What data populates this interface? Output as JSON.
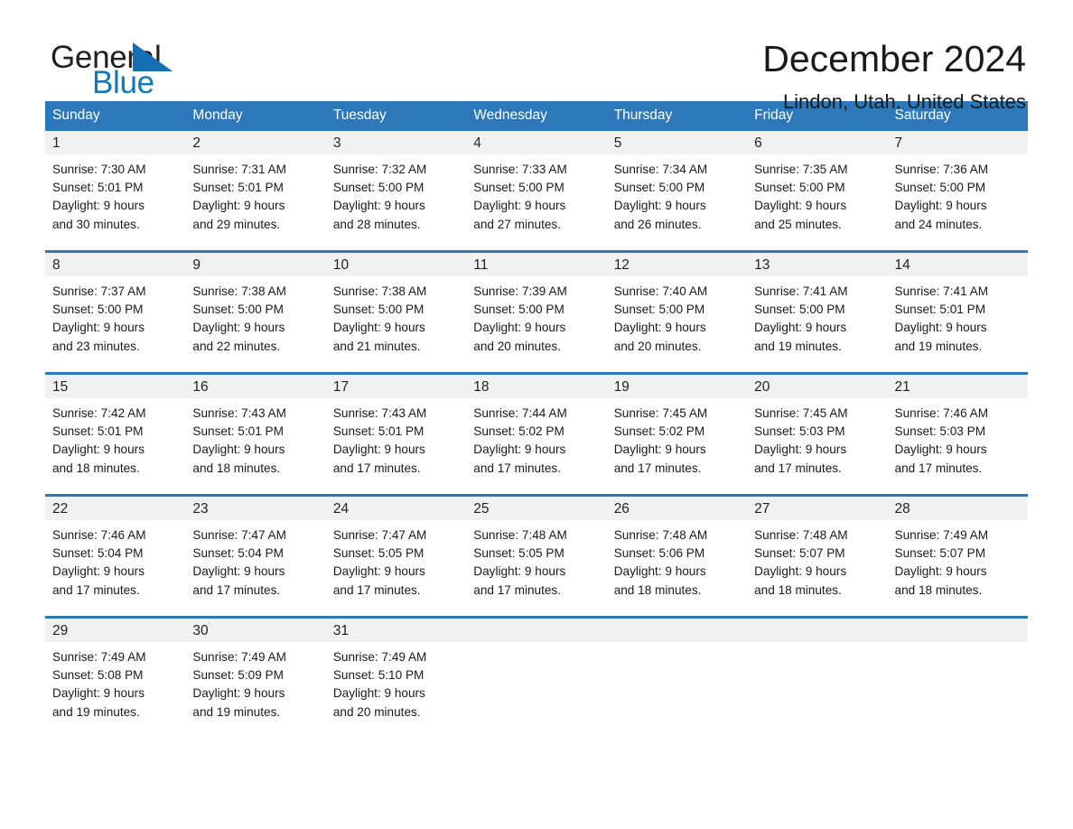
{
  "brand": {
    "name_part1": "General",
    "name_part2": "Blue",
    "triangle_color": "#1470b6",
    "blue_text_color": "#1278be"
  },
  "header": {
    "title": "December 2024",
    "subtitle": "Lindon, Utah, United States"
  },
  "colors": {
    "header_blue": "#2c78b9",
    "daynum_bg": "#f1f1f1",
    "text": "#1a1a1a"
  },
  "weekdays": [
    "Sunday",
    "Monday",
    "Tuesday",
    "Wednesday",
    "Thursday",
    "Friday",
    "Saturday"
  ],
  "weeks": [
    [
      {
        "day": "1",
        "sunrise": "Sunrise: 7:30 AM",
        "sunset": "Sunset: 5:01 PM",
        "daylight_line1": "Daylight: 9 hours",
        "daylight_line2": "and 30 minutes."
      },
      {
        "day": "2",
        "sunrise": "Sunrise: 7:31 AM",
        "sunset": "Sunset: 5:01 PM",
        "daylight_line1": "Daylight: 9 hours",
        "daylight_line2": "and 29 minutes."
      },
      {
        "day": "3",
        "sunrise": "Sunrise: 7:32 AM",
        "sunset": "Sunset: 5:00 PM",
        "daylight_line1": "Daylight: 9 hours",
        "daylight_line2": "and 28 minutes."
      },
      {
        "day": "4",
        "sunrise": "Sunrise: 7:33 AM",
        "sunset": "Sunset: 5:00 PM",
        "daylight_line1": "Daylight: 9 hours",
        "daylight_line2": "and 27 minutes."
      },
      {
        "day": "5",
        "sunrise": "Sunrise: 7:34 AM",
        "sunset": "Sunset: 5:00 PM",
        "daylight_line1": "Daylight: 9 hours",
        "daylight_line2": "and 26 minutes."
      },
      {
        "day": "6",
        "sunrise": "Sunrise: 7:35 AM",
        "sunset": "Sunset: 5:00 PM",
        "daylight_line1": "Daylight: 9 hours",
        "daylight_line2": "and 25 minutes."
      },
      {
        "day": "7",
        "sunrise": "Sunrise: 7:36 AM",
        "sunset": "Sunset: 5:00 PM",
        "daylight_line1": "Daylight: 9 hours",
        "daylight_line2": "and 24 minutes."
      }
    ],
    [
      {
        "day": "8",
        "sunrise": "Sunrise: 7:37 AM",
        "sunset": "Sunset: 5:00 PM",
        "daylight_line1": "Daylight: 9 hours",
        "daylight_line2": "and 23 minutes."
      },
      {
        "day": "9",
        "sunrise": "Sunrise: 7:38 AM",
        "sunset": "Sunset: 5:00 PM",
        "daylight_line1": "Daylight: 9 hours",
        "daylight_line2": "and 22 minutes."
      },
      {
        "day": "10",
        "sunrise": "Sunrise: 7:38 AM",
        "sunset": "Sunset: 5:00 PM",
        "daylight_line1": "Daylight: 9 hours",
        "daylight_line2": "and 21 minutes."
      },
      {
        "day": "11",
        "sunrise": "Sunrise: 7:39 AM",
        "sunset": "Sunset: 5:00 PM",
        "daylight_line1": "Daylight: 9 hours",
        "daylight_line2": "and 20 minutes."
      },
      {
        "day": "12",
        "sunrise": "Sunrise: 7:40 AM",
        "sunset": "Sunset: 5:00 PM",
        "daylight_line1": "Daylight: 9 hours",
        "daylight_line2": "and 20 minutes."
      },
      {
        "day": "13",
        "sunrise": "Sunrise: 7:41 AM",
        "sunset": "Sunset: 5:00 PM",
        "daylight_line1": "Daylight: 9 hours",
        "daylight_line2": "and 19 minutes."
      },
      {
        "day": "14",
        "sunrise": "Sunrise: 7:41 AM",
        "sunset": "Sunset: 5:01 PM",
        "daylight_line1": "Daylight: 9 hours",
        "daylight_line2": "and 19 minutes."
      }
    ],
    [
      {
        "day": "15",
        "sunrise": "Sunrise: 7:42 AM",
        "sunset": "Sunset: 5:01 PM",
        "daylight_line1": "Daylight: 9 hours",
        "daylight_line2": "and 18 minutes."
      },
      {
        "day": "16",
        "sunrise": "Sunrise: 7:43 AM",
        "sunset": "Sunset: 5:01 PM",
        "daylight_line1": "Daylight: 9 hours",
        "daylight_line2": "and 18 minutes."
      },
      {
        "day": "17",
        "sunrise": "Sunrise: 7:43 AM",
        "sunset": "Sunset: 5:01 PM",
        "daylight_line1": "Daylight: 9 hours",
        "daylight_line2": "and 17 minutes."
      },
      {
        "day": "18",
        "sunrise": "Sunrise: 7:44 AM",
        "sunset": "Sunset: 5:02 PM",
        "daylight_line1": "Daylight: 9 hours",
        "daylight_line2": "and 17 minutes."
      },
      {
        "day": "19",
        "sunrise": "Sunrise: 7:45 AM",
        "sunset": "Sunset: 5:02 PM",
        "daylight_line1": "Daylight: 9 hours",
        "daylight_line2": "and 17 minutes."
      },
      {
        "day": "20",
        "sunrise": "Sunrise: 7:45 AM",
        "sunset": "Sunset: 5:03 PM",
        "daylight_line1": "Daylight: 9 hours",
        "daylight_line2": "and 17 minutes."
      },
      {
        "day": "21",
        "sunrise": "Sunrise: 7:46 AM",
        "sunset": "Sunset: 5:03 PM",
        "daylight_line1": "Daylight: 9 hours",
        "daylight_line2": "and 17 minutes."
      }
    ],
    [
      {
        "day": "22",
        "sunrise": "Sunrise: 7:46 AM",
        "sunset": "Sunset: 5:04 PM",
        "daylight_line1": "Daylight: 9 hours",
        "daylight_line2": "and 17 minutes."
      },
      {
        "day": "23",
        "sunrise": "Sunrise: 7:47 AM",
        "sunset": "Sunset: 5:04 PM",
        "daylight_line1": "Daylight: 9 hours",
        "daylight_line2": "and 17 minutes."
      },
      {
        "day": "24",
        "sunrise": "Sunrise: 7:47 AM",
        "sunset": "Sunset: 5:05 PM",
        "daylight_line1": "Daylight: 9 hours",
        "daylight_line2": "and 17 minutes."
      },
      {
        "day": "25",
        "sunrise": "Sunrise: 7:48 AM",
        "sunset": "Sunset: 5:05 PM",
        "daylight_line1": "Daylight: 9 hours",
        "daylight_line2": "and 17 minutes."
      },
      {
        "day": "26",
        "sunrise": "Sunrise: 7:48 AM",
        "sunset": "Sunset: 5:06 PM",
        "daylight_line1": "Daylight: 9 hours",
        "daylight_line2": "and 18 minutes."
      },
      {
        "day": "27",
        "sunrise": "Sunrise: 7:48 AM",
        "sunset": "Sunset: 5:07 PM",
        "daylight_line1": "Daylight: 9 hours",
        "daylight_line2": "and 18 minutes."
      },
      {
        "day": "28",
        "sunrise": "Sunrise: 7:49 AM",
        "sunset": "Sunset: 5:07 PM",
        "daylight_line1": "Daylight: 9 hours",
        "daylight_line2": "and 18 minutes."
      }
    ],
    [
      {
        "day": "29",
        "sunrise": "Sunrise: 7:49 AM",
        "sunset": "Sunset: 5:08 PM",
        "daylight_line1": "Daylight: 9 hours",
        "daylight_line2": "and 19 minutes."
      },
      {
        "day": "30",
        "sunrise": "Sunrise: 7:49 AM",
        "sunset": "Sunset: 5:09 PM",
        "daylight_line1": "Daylight: 9 hours",
        "daylight_line2": "and 19 minutes."
      },
      {
        "day": "31",
        "sunrise": "Sunrise: 7:49 AM",
        "sunset": "Sunset: 5:10 PM",
        "daylight_line1": "Daylight: 9 hours",
        "daylight_line2": "and 20 minutes."
      },
      null,
      null,
      null,
      null
    ]
  ]
}
